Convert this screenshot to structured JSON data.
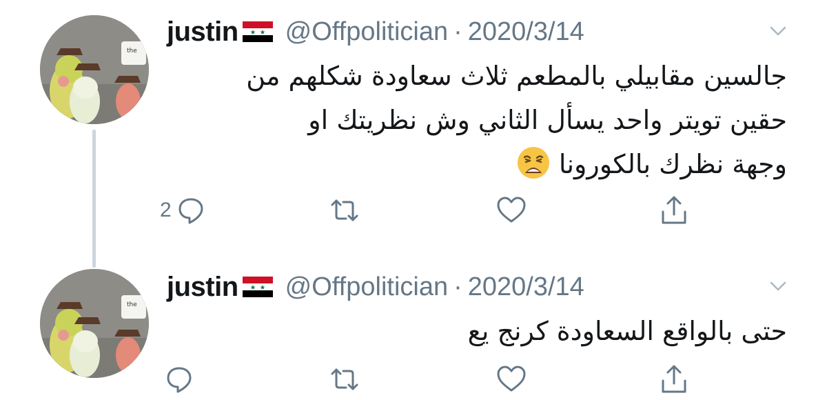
{
  "tweets": [
    {
      "name": "justin",
      "handle": "@Offpolitician",
      "separator": "·",
      "date": "2020/3/14",
      "lines": [
        "جالسين مقابيلي بالمطعم ثلاث سعاودة شكلهم من",
        "حقين تويتر واحد يسأل الثاني وش نظريتك او",
        "وجهة نظرك بالكورونا"
      ],
      "emoji": "weary-face",
      "reply_count": "2",
      "avatar_sign_text": "the"
    },
    {
      "name": "justin",
      "handle": "@Offpolitician",
      "separator": "·",
      "date": "2020/3/14",
      "lines": [
        "حتى بالواقع السعاودة كرنج يع"
      ],
      "reply_count": "",
      "avatar_sign_text": "the"
    }
  ],
  "icons": {
    "reply": "reply-icon",
    "retweet": "retweet-icon",
    "like": "like-icon",
    "share": "share-icon",
    "caret": "chevron-down-icon",
    "flag": "syria-flag-icon"
  },
  "colors": {
    "text": "#14171a",
    "secondary": "#657786",
    "thread_line": "#ccd6dd"
  }
}
